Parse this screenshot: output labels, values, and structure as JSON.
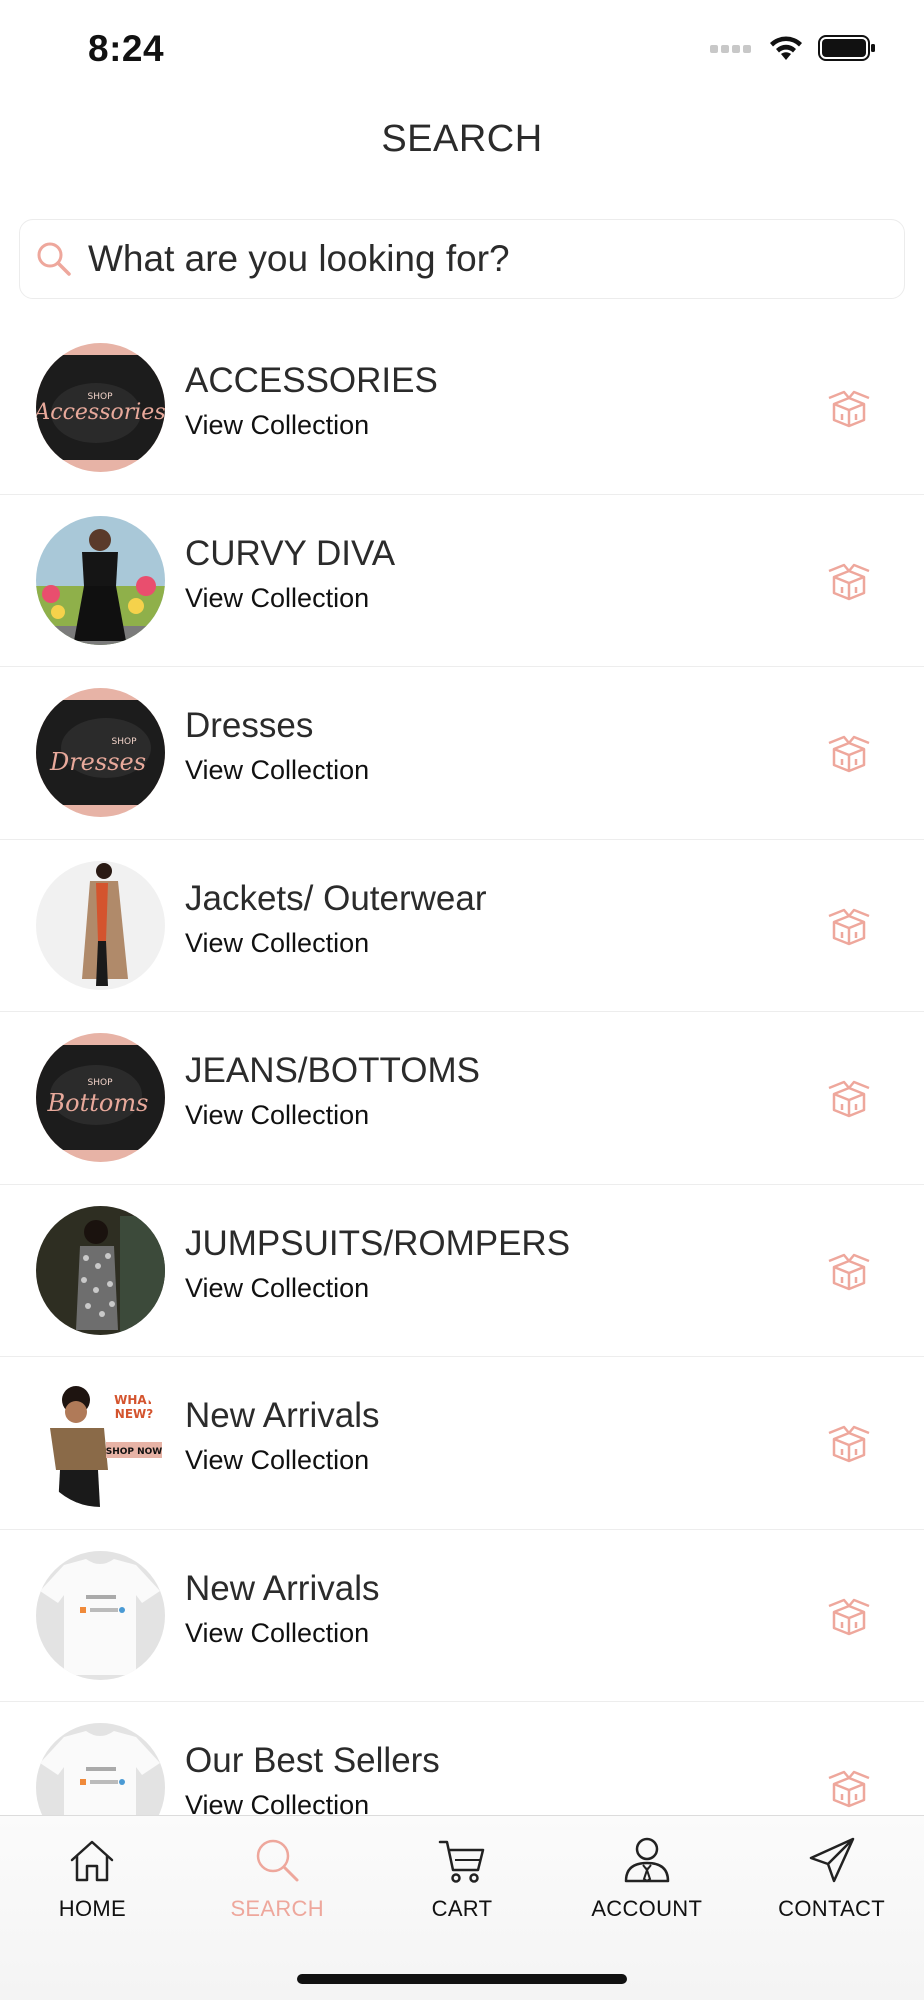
{
  "status_bar": {
    "time": "8:24"
  },
  "page": {
    "title": "SEARCH"
  },
  "search": {
    "placeholder": "What are you looking for?"
  },
  "collections": [
    {
      "title": "ACCESSORIES",
      "subtitle": "View Collection",
      "thumb": "accessories-banner",
      "thumb_script": "Accessories"
    },
    {
      "title": "CURVY DIVA",
      "subtitle": "View Collection",
      "thumb": "curvy-diva-photo"
    },
    {
      "title": "Dresses",
      "subtitle": "View Collection",
      "thumb": "dresses-banner",
      "thumb_script": "Dresses"
    },
    {
      "title": "Jackets/ Outerwear",
      "subtitle": "View Collection",
      "thumb": "jacket-photo"
    },
    {
      "title": "JEANS/BOTTOMS",
      "subtitle": "View Collection",
      "thumb": "bottoms-banner",
      "thumb_script": "Bottoms"
    },
    {
      "title": "JUMPSUITS/ROMPERS",
      "subtitle": "View Collection",
      "thumb": "jumpsuit-photo"
    },
    {
      "title": "New Arrivals",
      "subtitle": "View Collection",
      "thumb": "new-arrivals-promo"
    },
    {
      "title": "New Arrivals",
      "subtitle": "View Collection",
      "thumb": "tshirt-photo"
    },
    {
      "title": "Our Best Sellers",
      "subtitle": "View Collection",
      "thumb": "tshirt-photo"
    }
  ],
  "row_icon": "gift-box-icon",
  "tabs": [
    {
      "label": "HOME",
      "icon": "home-icon",
      "active": false
    },
    {
      "label": "SEARCH",
      "icon": "search-icon",
      "active": true
    },
    {
      "label": "CART",
      "icon": "cart-icon",
      "active": false
    },
    {
      "label": "ACCOUNT",
      "icon": "account-icon",
      "active": false
    },
    {
      "label": "CONTACT",
      "icon": "paper-plane-icon",
      "active": false
    }
  ],
  "colors": {
    "accent": "#eea79c",
    "text": "#2b2b2b",
    "divider": "#ededed"
  }
}
